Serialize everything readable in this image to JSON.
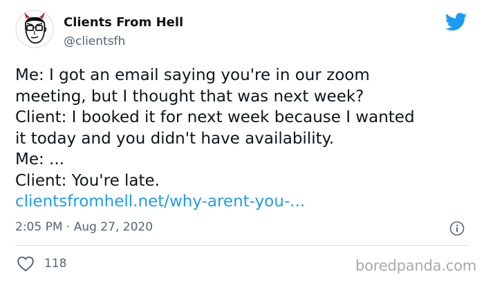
{
  "author": {
    "name": "Clients From Hell",
    "handle": "@clientsfh",
    "avatar_icon": "devil-horned-face-avatar-icon"
  },
  "brand": {
    "icon": "twitter-bird-icon",
    "accent_color": "#1d9bf0"
  },
  "tweet": {
    "lines": [
      "Me: I got an email saying you're in our zoom",
      "meeting, but I thought that was next week?",
      "Client: I booked it for next week because I wanted",
      "it today and you didn't have availability.",
      "Me: ...",
      "Client: You're late."
    ],
    "link_text": "clientsfromhell.net/why-arent-you-..."
  },
  "meta": {
    "timestamp": "2:05 PM · Aug 27, 2020",
    "info_icon": "info-icon"
  },
  "engagement": {
    "like_icon": "heart-icon",
    "likes": "118"
  },
  "watermark": "boredpanda.com"
}
